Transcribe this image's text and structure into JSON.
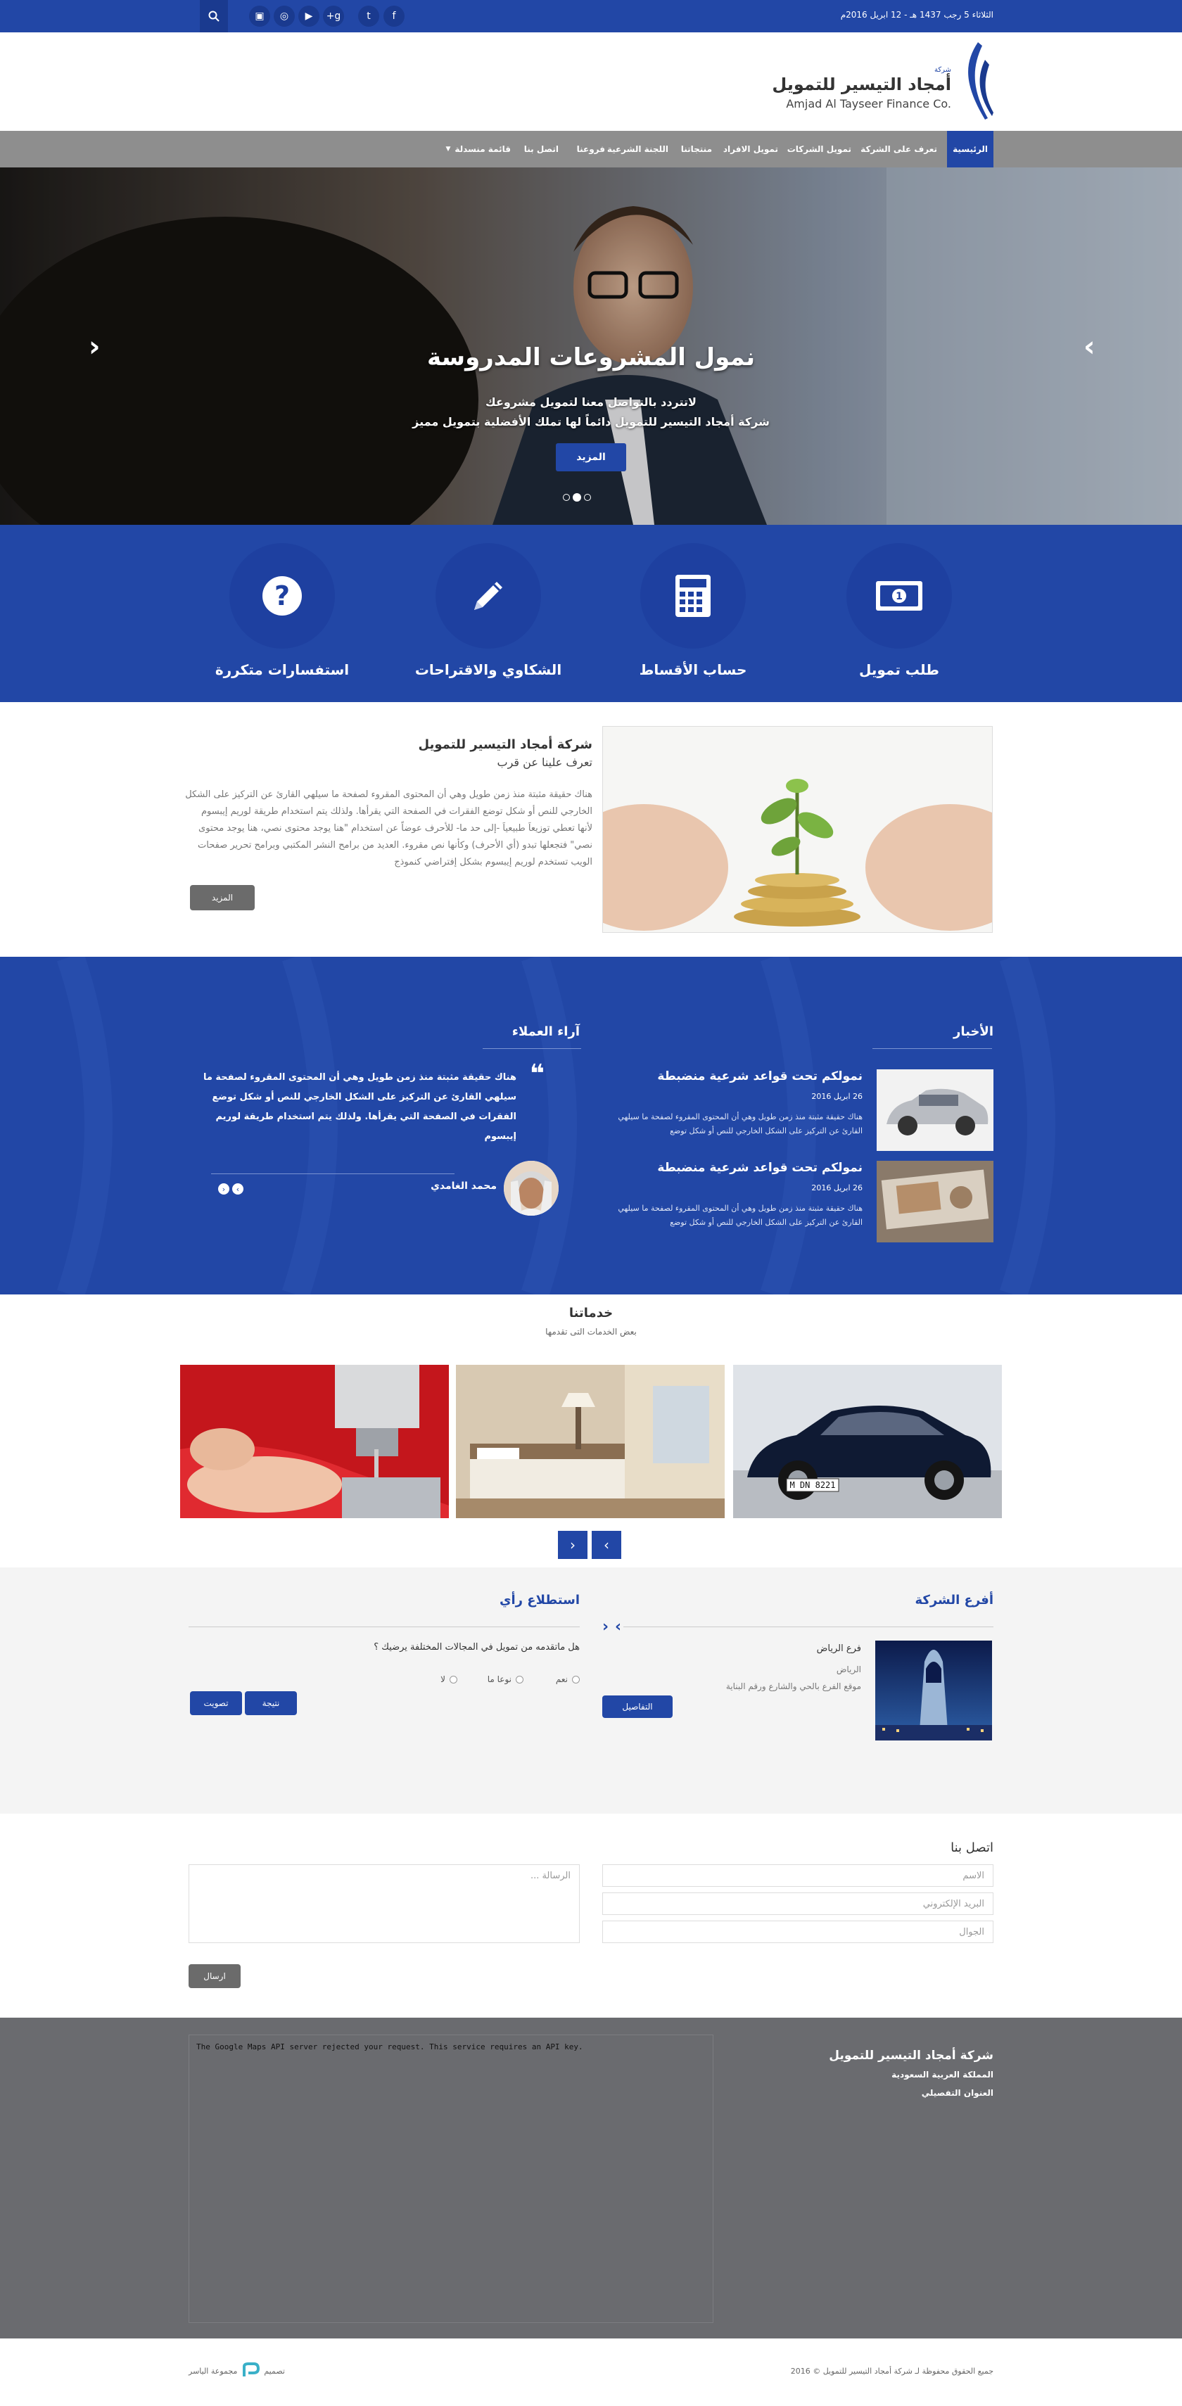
{
  "topbar": {
    "date": "الثلاثاء 5 رجب 1437 هـ - 12 ابريل 2016م",
    "icons": [
      "facebook-icon",
      "twitter-icon",
      "google-plus-icon",
      "youtube-icon",
      "instagram-icon",
      "linkedin-icon",
      "search-icon"
    ]
  },
  "header": {
    "logo_small": "شركة",
    "logo_ar": "أمجاد التيسير للتمويل",
    "logo_en": "Amjad Al Tayseer Finance Co."
  },
  "nav": {
    "items": [
      "الرئيسية",
      "تعرف على الشركة",
      "تمويل الشركات",
      "تمويل الافراد",
      "منتجاتنا",
      "اللجنة الشرعية",
      "فروعنا",
      "اتصل بنا",
      "قائمة منسدلة"
    ],
    "dropdown_icon": "caret-down-icon"
  },
  "hero": {
    "title": "نمول المشروعات المدروسة",
    "line1": "لاتتردد بالتواصل معنا لتمويل مشروعك",
    "line2": "شركة أمجاد التيسير للتمويل دائماً لها تملك الأفضلية بتمويل مميز",
    "button": "المزيد"
  },
  "features": [
    {
      "label": "طلب تمويل",
      "icon": "money-icon"
    },
    {
      "label": "حساب الأقساط",
      "icon": "calculator-icon"
    },
    {
      "label": "الشكاوي والاقتراحات",
      "icon": "pencil-icon"
    },
    {
      "label": "استفسارات متكررة",
      "icon": "question-icon"
    }
  ],
  "about": {
    "title": "شركة أمجاد التيسير للتمويل",
    "subtitle": "تعرف علينا عن قرب",
    "body": "هناك حقيقة مثبتة منذ زمن طويل وهي أن المحتوى المقروء لصفحة ما سيلهي القارئ عن التركيز على الشكل الخارجي للنص أو شكل توضع الفقرات في الصفحة التي يقرأها. ولذلك يتم استخدام طريقة لوريم إيبسوم لأنها تعطي توزيعاَ طبيعياَ -إلى حد ما- للأحرف عوضاً عن استخدام \"هنا يوجد محتوى نصي، هنا يوجد محتوى نصي\" فتجعلها تبدو (أي الأحرف) وكأنها نص مقروء. العديد من برامح النشر المكتبي وبرامح تحرير صفحات الويب تستخدم لوريم إيبسوم بشكل إفتراضي كنموذج",
    "button": "المزيد"
  },
  "news": {
    "heading": "الأخبار",
    "items": [
      {
        "title": "نمولكم تحت قواعد شرعية منضبطة",
        "date": "26 ابريل 2016",
        "text": "هناك حقيقة مثبتة منذ زمن طويل وهي أن المحتوى المقروء لصفحة ما سيلهي القارئ عن التركيز على الشكل الخارجي للنص أو شكل توضع"
      },
      {
        "title": "نمولكم تحت قواعد شرعية منضبطة",
        "date": "26 ابريل 2016",
        "text": "هناك حقيقة مثبتة منذ زمن طويل وهي أن المحتوى المقروء لصفحة ما سيلهي القارئ عن التركيز على الشكل الخارجي للنص أو شكل توضع"
      }
    ]
  },
  "testimonials": {
    "heading": "آراء العملاء",
    "quote": "هناك حقيقة مثبتة منذ زمن طويل وهي أن المحتوى المقروء لصفحة ما سيلهي القارئ عن التركيز على الشكل الخارجي للنص أو شكل توضع الفقرات في الصفحة التي يقرأها. ولذلك يتم استخدام طريقة لوريم إيبسوم",
    "name": "محمد الغامدي"
  },
  "services": {
    "title": "خدماتنا",
    "subtitle": "بعض الخدمات التى تقدمها",
    "plate": "M DN 8221"
  },
  "branches": {
    "heading": "أفرع الشركة",
    "name": "فرع الرياض",
    "city": "الرياض",
    "address": "موقع الفرع بالحي والشارع ورقم البناية",
    "button": "التفاصيل"
  },
  "poll": {
    "heading": "استطلاع رأي",
    "question": "هل ماتقدمه من تمويل في المجالات المختلفة يرضيك ؟",
    "options": [
      "نعم",
      "نوعا ما",
      "لا"
    ],
    "result_button": "نتيجة",
    "vote_button": "تصويت"
  },
  "contact": {
    "heading": "اتصل بنا",
    "name_ph": "الاسم",
    "email_ph": "البريد الإلكتروني",
    "mobile_ph": "الجوال",
    "message_ph": "الرسالة ...",
    "send": "ارسال"
  },
  "map": {
    "error": "The Google Maps API server rejected your request. This service requires an API key.",
    "company": "شركة أمجاد التيسير للتمويل",
    "country": "المملكة العربية السعودية",
    "address": "العنوان التفصيلي"
  },
  "footer": {
    "copyright": "جميع الحقوق محفوظة لـ شركة أمجاد التيسير للتمويل © 2016",
    "design": "تصميم",
    "designer": "مجموعة الياسر"
  },
  "colors": {
    "primary": "#2247a6",
    "nav": "#8e8e8e",
    "map": "#6a6b6f"
  }
}
